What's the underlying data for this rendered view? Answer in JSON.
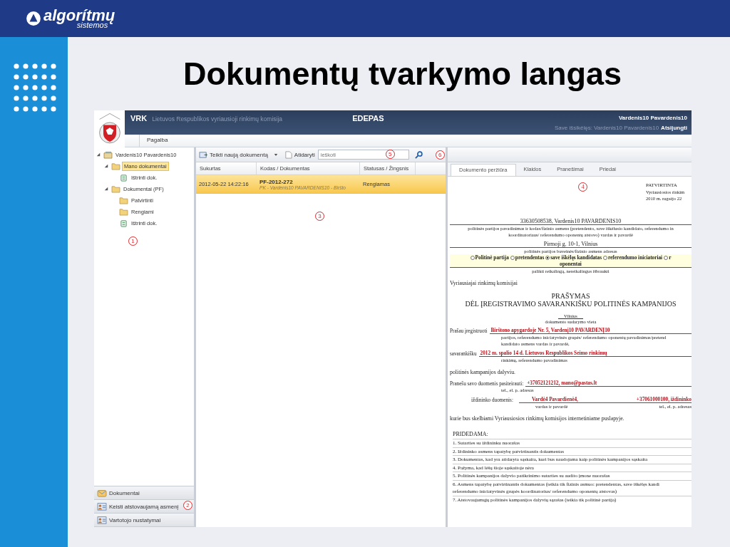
{
  "slide": {
    "logo": "algorítmų",
    "logo_sub": "sistemos",
    "title": "Dokumentų tvarkymo langas"
  },
  "app": {
    "header": {
      "brand": "VRK",
      "subtitle": "Lietuvos Respublikos vyriausioji rinkimų komisija",
      "product": "EDEPAS",
      "user": "Vardenis10 Pavardenis10",
      "nominee_label": "Save išsikėlęs: Vardenis10 Pavardenis10",
      "logout": "Atsijungti"
    },
    "menu": [
      "Pagalba"
    ],
    "tree": {
      "marker": "1",
      "items": [
        {
          "label": "Vardenis10 Pavardenis10",
          "kind": "user",
          "selected": false,
          "expanded": true,
          "children": [
            {
              "label": "Mano dokumentai",
              "kind": "folder",
              "selected": true,
              "expanded": true,
              "children": [
                {
                  "label": "Ištrinti dok.",
                  "kind": "trash",
                  "selected": false
                }
              ]
            },
            {
              "label": "Dokumentai (PF)",
              "kind": "folder",
              "selected": false,
              "expanded": true,
              "children": [
                {
                  "label": "Patvirtinti",
                  "kind": "folder",
                  "selected": false
                },
                {
                  "label": "Rengiami",
                  "kind": "folder",
                  "selected": false
                },
                {
                  "label": "Ištrinti dok.",
                  "kind": "trash",
                  "selected": false
                }
              ]
            }
          ]
        }
      ]
    },
    "nav_buttons": {
      "marker": "2",
      "items": [
        {
          "label": "Dokumentai",
          "kind": "mail"
        },
        {
          "label": "Keisti atstovaujamą asmenį",
          "kind": "card"
        },
        {
          "label": "Vartotojo nustatymai",
          "kind": "card"
        }
      ]
    },
    "toolbar": {
      "new_doc": "Teikti naują dokumentą",
      "open": "Atidaryti",
      "search": {
        "placeholder": "ieškoti",
        "marker": "5"
      },
      "marker": "6"
    },
    "grid": {
      "marker": "3",
      "columns": [
        "Sukurtas",
        "Kodas / Dokumentas",
        "Statusas / Žingsnis"
      ],
      "rows": [
        {
          "created": "2012-05-22 14:22:16",
          "code": "PF-2012-272",
          "document": "PK - Vardenis10 PAVARDENIS10 - Biršto",
          "status": "Rengiamas",
          "selected": true
        }
      ]
    },
    "preview": {
      "marker": "4",
      "tabs": [
        {
          "label": "Dokumento peržiūra",
          "selected": true
        },
        {
          "label": "Klaidos",
          "selected": false
        },
        {
          "label": "Pranešimai",
          "selected": false
        },
        {
          "label": "Priedai",
          "selected": false
        }
      ],
      "approval": [
        "PATVIRTINTA",
        "Vyriausiosios rinkim",
        "2010 m. rugsėjo 22"
      ],
      "blocks": [
        {
          "kind": "value",
          "text": "33630508538, Vardenis10 PAVARDENIS10"
        },
        {
          "kind": "caption",
          "text": "politinės partijos pavadinimas ir kodas/fizinio asmens (pretendento, save iškėlusio kandidato, referendumo in"
        },
        {
          "kind": "caption",
          "text": "koordinatoriaus/ referendumo oponentų atstovo) vardas ir pavardė"
        },
        {
          "kind": "value",
          "text": "Pirmoji g. 10-1, Vilnius"
        },
        {
          "kind": "caption",
          "text": "politinės partijos buveinės/fizinio asmens adresas"
        },
        {
          "kind": "radios",
          "options": [
            {
              "label": "Politinė partija",
              "selected": false
            },
            {
              "label": "pretendentas",
              "selected": false
            },
            {
              "label": "save iškėlęs kandidatas",
              "selected": true
            },
            {
              "label": "referendumo iniciatoriai",
              "selected": false
            },
            {
              "label": "r",
              "selected": false
            }
          ],
          "wrap": "oponentai"
        },
        {
          "kind": "caption",
          "text": "palikti reikalingą, nereikalingus išbraukti"
        },
        {
          "kind": "para",
          "text": "Vyriausiajai rinkimų komisijai"
        },
        {
          "kind": "heading",
          "text": "PRAŠYMAS"
        },
        {
          "kind": "heading",
          "text": "DĖL ĮREGISTRAVIMO SAVARANKIŠKU POLITINĖS KAMPANIJOS"
        },
        {
          "kind": "place",
          "text": "Vilnius",
          "caption": "dokumento sudarymo vieta"
        },
        {
          "kind": "fill",
          "label": "Prašau įregistruoti",
          "value": "Birštono apygardoje Nr. 5, Vardenį10 PAVARDENĮ10",
          "captions": [
            "partijos, referendumo iniciatyvinės grupės/ referendumo oponentų pavadinimas/pretend",
            "kandidato asmens vardas ir pavardė,"
          ]
        },
        {
          "kind": "fill",
          "label": "savarankišku",
          "value": "2012 m. spalio 14 d. Lietuvos Respublikos Seimo rinkimų",
          "captions": [
            "rinkimų, referendumo pavadinimas"
          ]
        },
        {
          "kind": "para",
          "text": "politinės kampanijos dalyviu."
        },
        {
          "kind": "fill",
          "label": "Pranešu savo duomenis pasiteirauti:",
          "value": "+37052121212, mano@pastas.lt",
          "captions": [
            "tel., el. p. adresas"
          ]
        },
        {
          "kind": "fill2",
          "label": "iždininko duomenis:",
          "values": [
            "Vardė4 Pavardienė4,",
            "+37061000100, iždininko"
          ],
          "captions": [
            "vardas ir pavardė",
            "tel., el. p. adresas"
          ]
        },
        {
          "kind": "para",
          "text": "kurie bus skelbiami Vyriausiosios rinkimų komisijos internetiniame puslapyje."
        },
        {
          "kind": "list",
          "title": "PRIDEDAMA:",
          "items": [
            "1. Sutarties su iždininku nuorašas",
            "2. Iždininko asmens tapatybę patvirtinantis dokumentas",
            "3. Dokumentas, kad yra atidaryta sąskaita, kuri bus naudojama kaip politinės kampanijos sąskaita",
            "4. Pažyma, kad lėšų šioje sąskaitoje nėra",
            "5. Politinės kampanijos dalyvio patikrinimo sutarties su audito įmone nuorašas",
            "6. Asmens tapatybę patvirtinantis dokumentas (teikia tik fizinis asmuo: pretendentas, save iškėlęs kandi\nreferendumo iniciatyvinės grupės koordinatorius/ referendumo oponentų atstovas)",
            "7. Atstovaujamųjų politinės kampanijos dalyvių sąrašas (teikia tik politinė partija)"
          ]
        }
      ]
    }
  }
}
